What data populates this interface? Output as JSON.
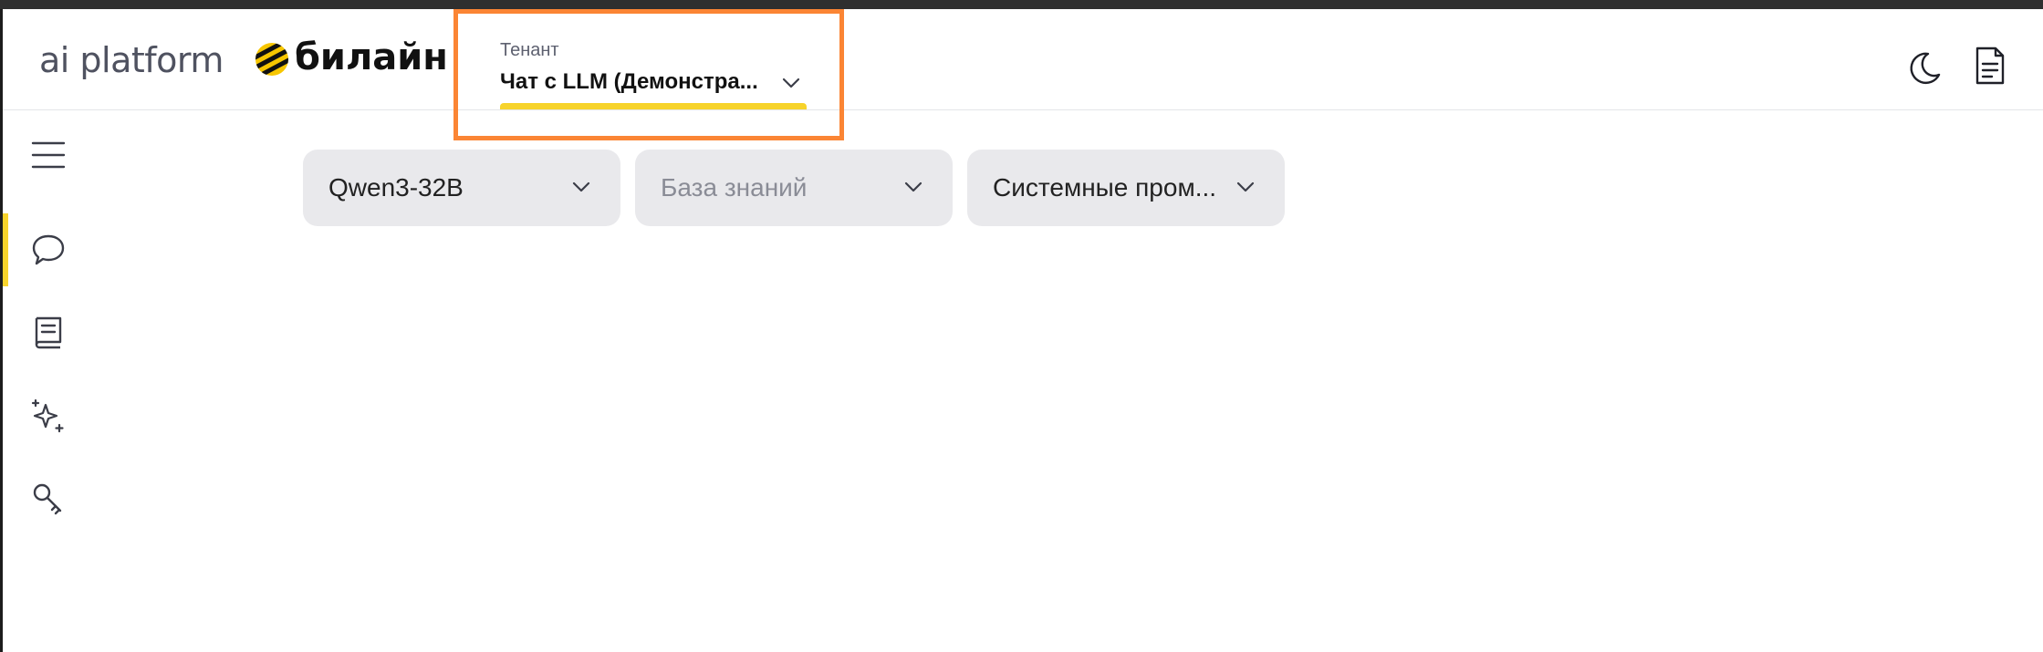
{
  "header": {
    "brand": "ai platform",
    "company": "билайн",
    "tenant": {
      "label": "Тенант",
      "value": "Чат с LLM (Демонстра..."
    }
  },
  "icons": {
    "theme": "moon-icon",
    "docs": "document-icon",
    "menu": "hamburger-menu-icon",
    "chat": "chat-bubble-icon",
    "knowledge": "book-icon",
    "prompts": "sparkles-icon",
    "keys": "key-icon"
  },
  "sidebar": {
    "active_item": "chat"
  },
  "selectors": {
    "model": "Qwen3-32B",
    "knowledge_base_placeholder": "База знаний",
    "system_prompt": "Системные пром..."
  },
  "colors": {
    "accent": "#f7d32b",
    "highlight": "#fb8534",
    "selector_bg": "#e9e9ec"
  }
}
